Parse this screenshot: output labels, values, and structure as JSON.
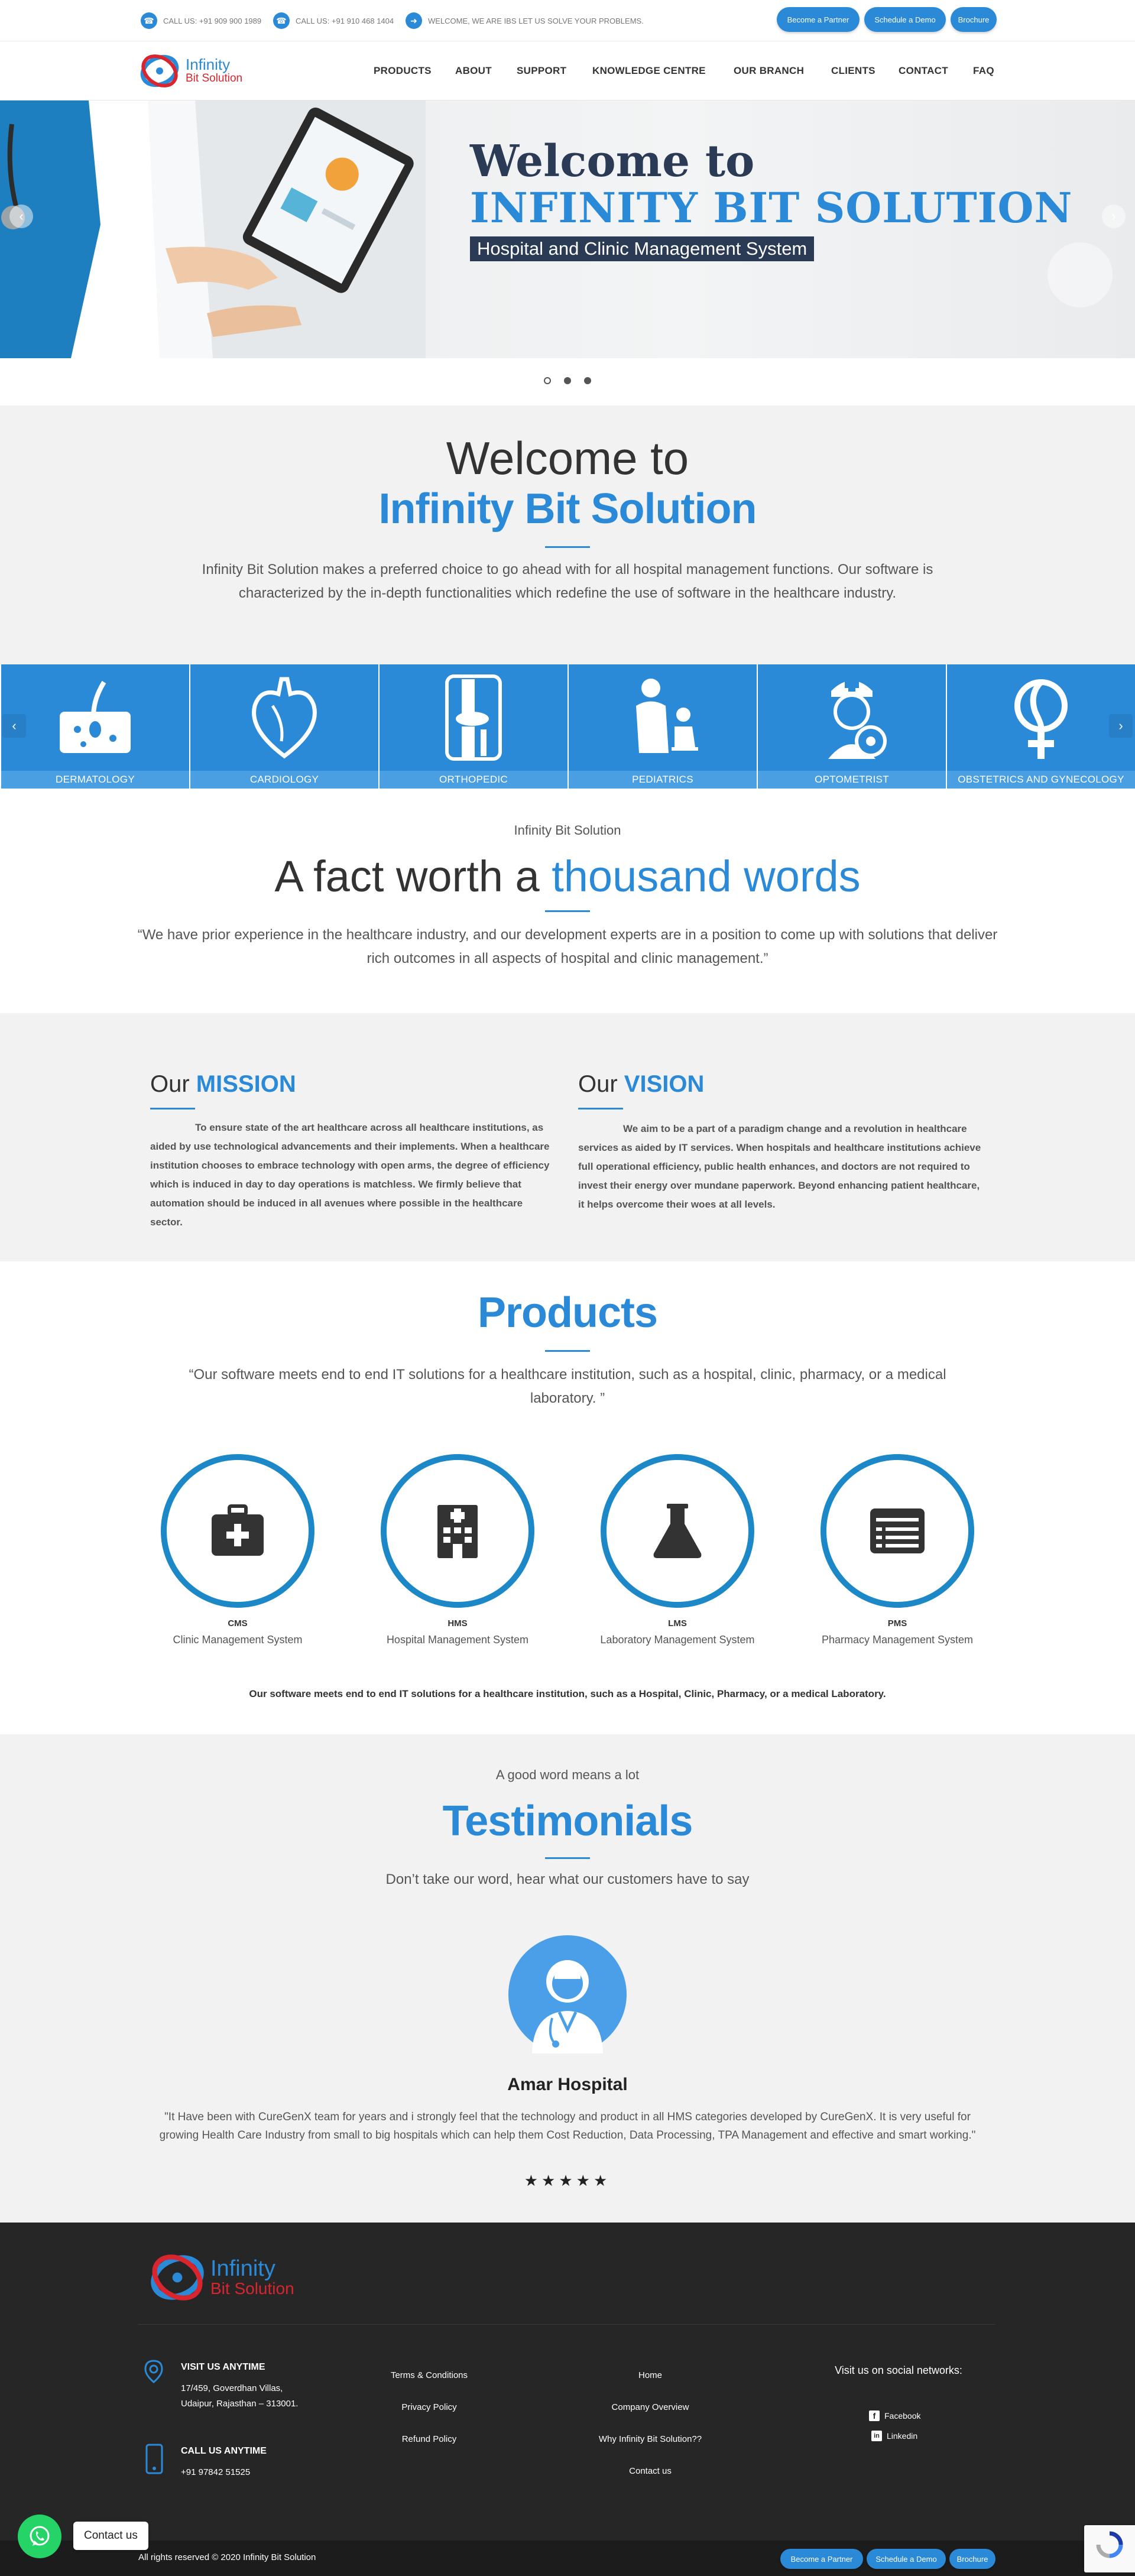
{
  "topbar": {
    "call1": "CALL US: +91 909 900 1989",
    "call2": "CALL US: +91 910 468 1404",
    "welcome": "WELCOME, WE ARE IBS LET US SOLVE YOUR PROBLEMS.",
    "partner": "Become a Partner",
    "demo": "Schedule a Demo",
    "brochure": "Brochure"
  },
  "logo": {
    "line1": "Infinity",
    "line2": "Bit Solution"
  },
  "nav": [
    "PRODUCTS",
    "ABOUT",
    "SUPPORT",
    "KNOWLEDGE CENTRE",
    "OUR BRANCH",
    "CLIENTS",
    "CONTACT",
    "FAQ"
  ],
  "hero": {
    "title1": "Welcome to",
    "title2": "INFINITY BIT SOLUTION",
    "subtitle": "Hospital and Clinic Management System"
  },
  "welcome": {
    "line1": "Welcome to",
    "line2": "Infinity Bit Solution",
    "text": "Infinity Bit Solution makes a preferred choice to go ahead with for all hospital management functions. Our software is characterized by the in-depth functionalities which redefine the use of software in the healthcare industry."
  },
  "specialities": [
    "DERMATOLOGY",
    "CARDIOLOGY",
    "ORTHOPEDIC",
    "PEDIATRICS",
    "OPTOMETRIST",
    "OBSTETRICS AND GYNECOLOGY"
  ],
  "fact": {
    "kicker": "Infinity Bit Solution",
    "heading_plain": "A fact worth a ",
    "heading_bold": "thousand words",
    "quote": "“We have prior experience in the healthcare industry, and our development experts are in a position to come up with solutions that deliver rich outcomes in all aspects of hospital and clinic management.”"
  },
  "mission": {
    "our": "Our ",
    "title": "MISSION",
    "text": "To ensure state of the art healthcare across all healthcare institutions, as aided by use technological advancements and their implements. When a healthcare institution chooses to embrace technology with open arms, the degree of efficiency which is induced in day to day operations is matchless. We firmly believe that automation should be induced in all avenues where possible in the healthcare sector."
  },
  "vision": {
    "our": "Our ",
    "title": "VISION",
    "text": "We aim to be a part of a paradigm change and a revolution in healthcare services as aided by IT services. When hospitals and healthcare institutions achieve full operational efficiency, public health enhances, and doctors are not required to invest their energy over mundane paperwork. Beyond enhancing patient healthcare, it helps overcome their woes at all levels."
  },
  "products": {
    "title": "Products",
    "quote": "“Our software meets end to end IT solutions for a healthcare institution, such as a hospital, clinic, pharmacy, or a medical laboratory. ”",
    "items": [
      {
        "code": "CMS",
        "name": "Clinic Management System"
      },
      {
        "code": "HMS",
        "name": "Hospital Management System"
      },
      {
        "code": "LMS",
        "name": "Laboratory Management System"
      },
      {
        "code": "PMS",
        "name": "Pharmacy Management System"
      }
    ],
    "note": "Our software meets end to end IT solutions for a healthcare institution, such as a Hospital, Clinic, Pharmacy, or a medical Laboratory."
  },
  "testimonials": {
    "kicker": "A good word means a lot",
    "title": "Testimonials",
    "subtitle": "Don’t take our word, hear what our customers have to say",
    "name": "Amar Hospital",
    "quote": "\"It Have been with CureGenX team for years and i strongly feel that the technology and product in all HMS categories developed by CureGenX. It is very useful for growing Health Care Industry from small to big hospitals which can help them Cost Reduction, Data Processing, TPA Management and effective and smart working.\"",
    "rating": 5
  },
  "footer": {
    "visit_title": "VISIT US ANYTIME",
    "address1": "17/459, Goverdhan Villas,",
    "address2": "Udaipur, Rajasthan – 313001.",
    "call_title": "CALL US ANYTIME",
    "phone": "+91 97842 51525",
    "links_col1": [
      "Terms & Conditions",
      "Privacy Policy",
      "Refund Policy"
    ],
    "links_col2": [
      "Home",
      "Company Overview",
      "Why Infinity Bit Solution??",
      "Contact us"
    ],
    "social_title": "Visit us on social networks:",
    "facebook": "Facebook",
    "linkedin": "Linkedin",
    "copyright": "All rights reserved © 2020 Infinity Bit Solution",
    "partner": "Become a Partner",
    "demo": "Schedule a Demo",
    "brochure": "Brochure"
  },
  "whatsapp": {
    "label": "Contact us"
  },
  "colors": {
    "accent": "#2b8ad8",
    "dark": "#2b3a55",
    "footer": "#262626",
    "brand_red": "#d8252e"
  }
}
